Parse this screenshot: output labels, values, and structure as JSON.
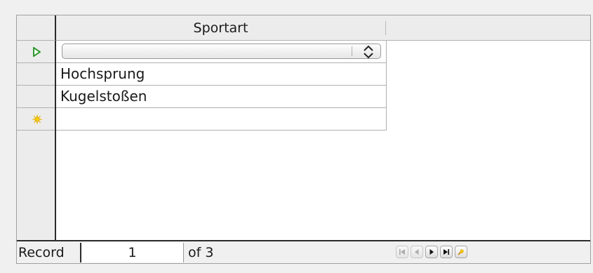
{
  "grid": {
    "column_header": "Sportart",
    "rows": [
      {
        "value": ""
      },
      {
        "value": "Hochsprung"
      },
      {
        "value": "Kugelstoßen"
      },
      {
        "value": ""
      }
    ],
    "row_indicators": [
      "current-row-arrow-icon",
      "",
      "",
      "new-record-star-icon"
    ]
  },
  "navigation": {
    "record_label": "Record",
    "current_record": "1",
    "of_text": "of 3",
    "buttons": [
      "first-record",
      "previous-record",
      "next-record",
      "last-record",
      "new-record"
    ]
  },
  "colors": {
    "current_arrow": "#2f9a2f",
    "new_star": "#e8b800",
    "border_dark": "#2b2b2b"
  }
}
